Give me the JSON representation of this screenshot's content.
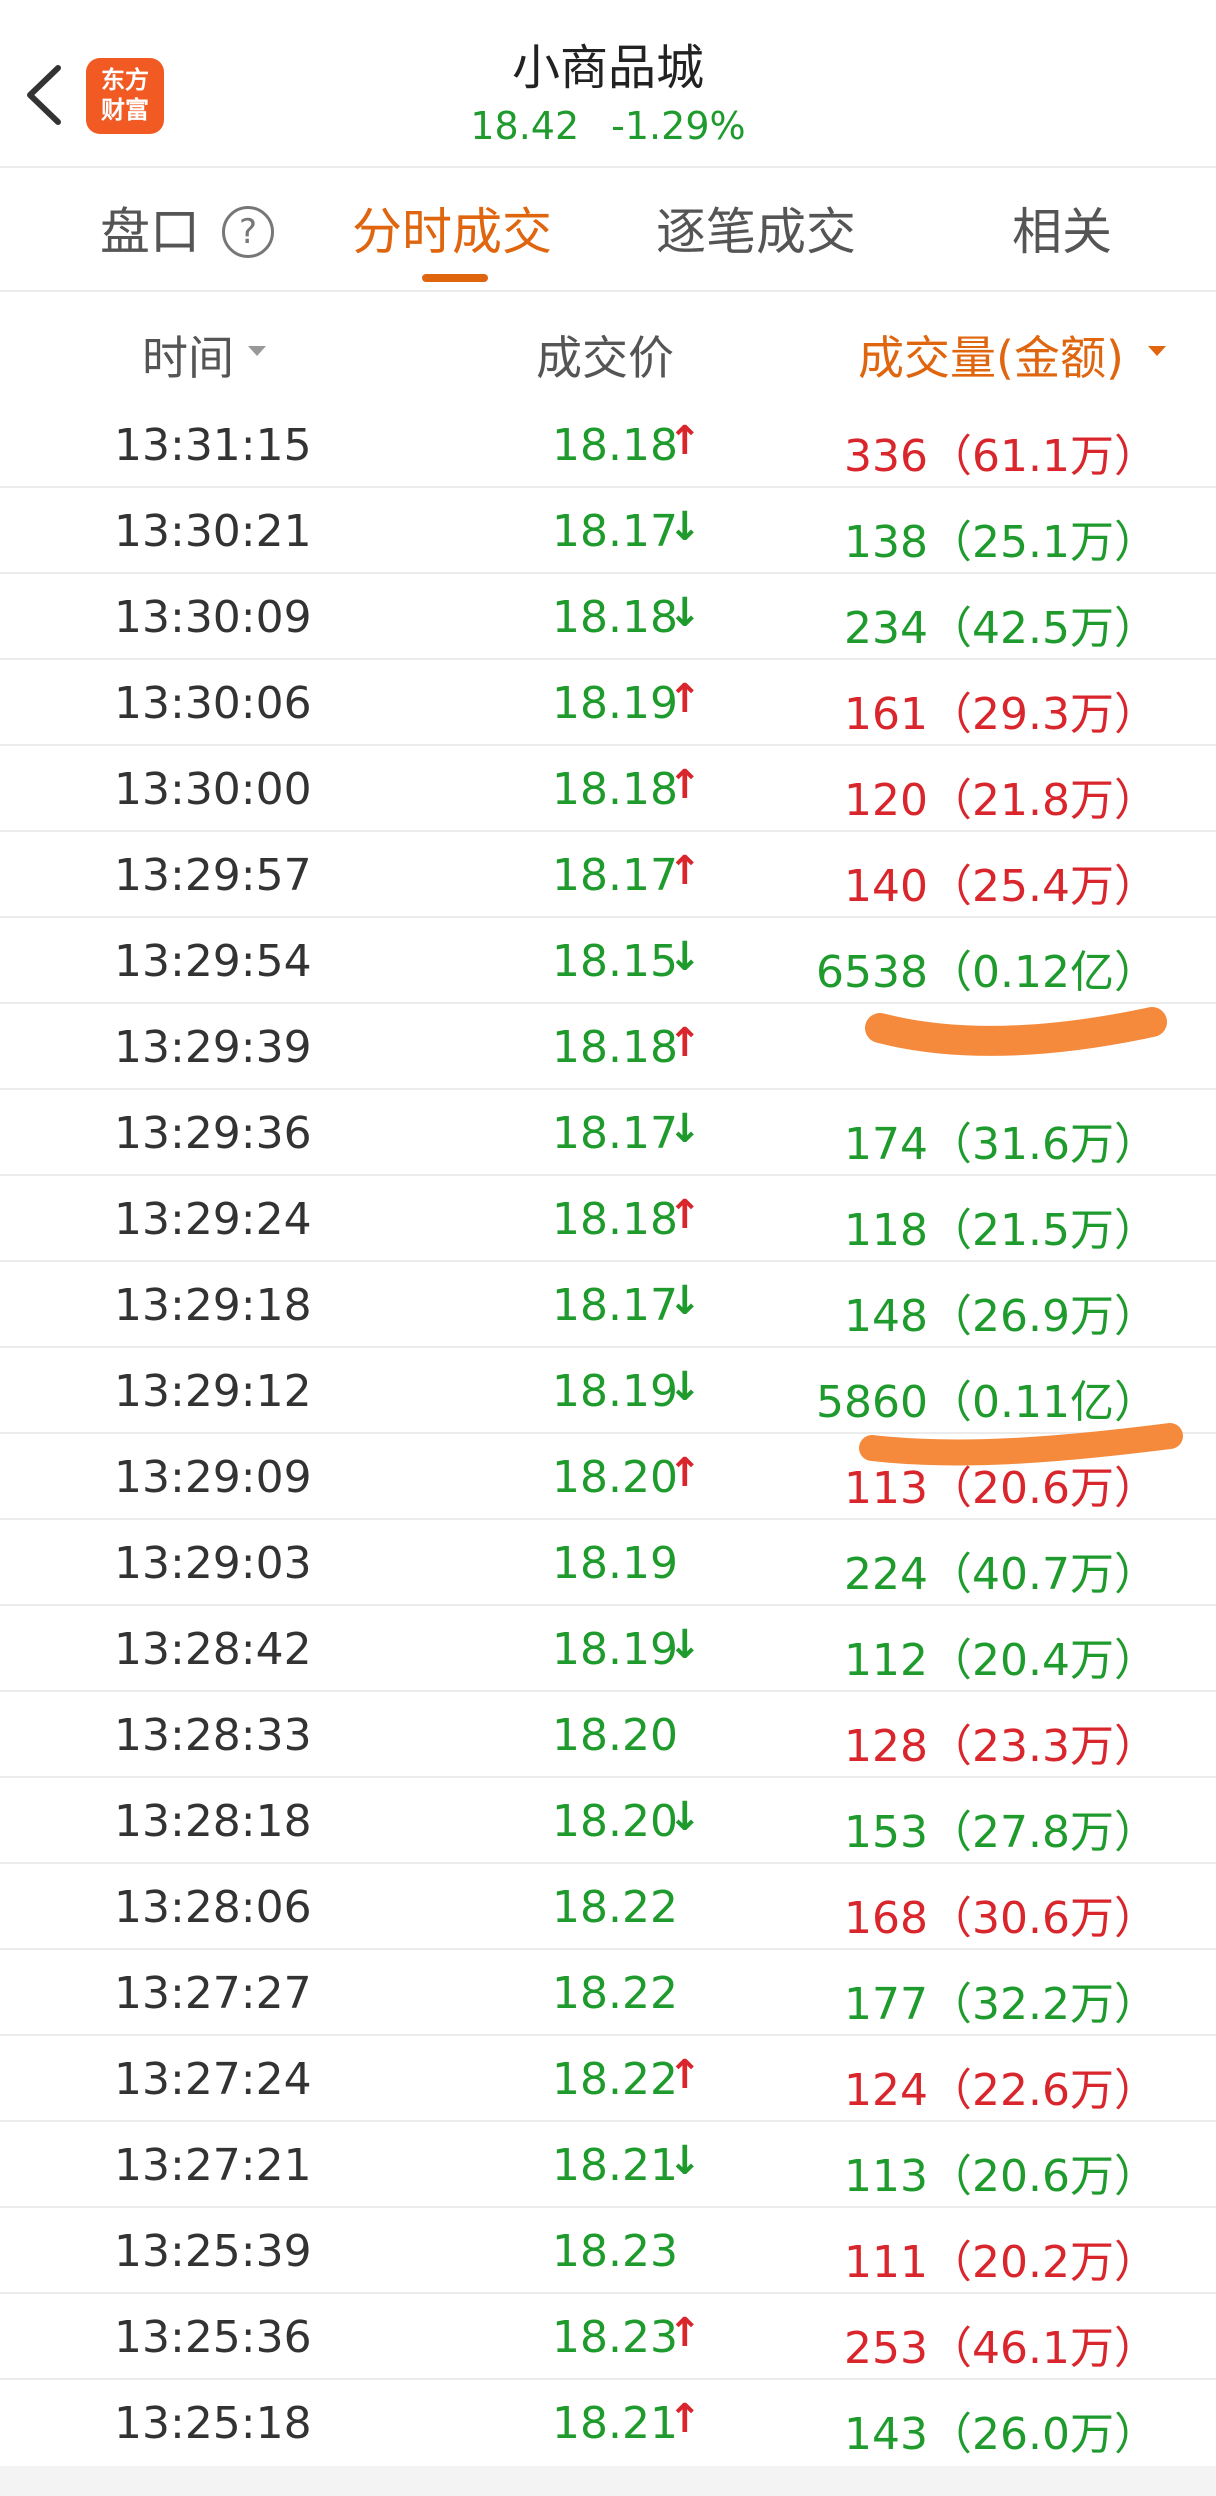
{
  "header": {
    "title": "小商品城",
    "price": "18.42",
    "change_pct": "-1.29%",
    "logo_line1": "东方",
    "logo_line2": "财富"
  },
  "tabs": [
    {
      "label": "盘口",
      "active": false
    },
    {
      "label": "分时成交",
      "active": true
    },
    {
      "label": "逐笔成交",
      "active": false
    },
    {
      "label": "相关",
      "active": false
    }
  ],
  "help_icon_glyph": "?",
  "columns": {
    "time": "时间",
    "price": "成交价",
    "volume": "成交量(金额)"
  },
  "colors": {
    "up": "#d9262c",
    "down": "#1f9b2e",
    "accent": "#e0650f",
    "highlighter": "#f58a3c"
  },
  "rows": [
    {
      "time": "13:31:15",
      "price": "18.18",
      "dir": "up",
      "vol": "336（61.1万）",
      "vol_color": "red"
    },
    {
      "time": "13:30:21",
      "price": "18.17",
      "dir": "down",
      "vol": "138（25.1万）",
      "vol_color": "green"
    },
    {
      "time": "13:30:09",
      "price": "18.18",
      "dir": "down",
      "vol": "234（42.5万）",
      "vol_color": "green"
    },
    {
      "time": "13:30:06",
      "price": "18.19",
      "dir": "up",
      "vol": "161（29.3万）",
      "vol_color": "red"
    },
    {
      "time": "13:30:00",
      "price": "18.18",
      "dir": "up",
      "vol": "120（21.8万）",
      "vol_color": "red"
    },
    {
      "time": "13:29:57",
      "price": "18.17",
      "dir": "up",
      "vol": "140（25.4万）",
      "vol_color": "red"
    },
    {
      "time": "13:29:54",
      "price": "18.15",
      "dir": "down",
      "vol": "6538（0.12亿）",
      "vol_color": "green"
    },
    {
      "time": "13:29:39",
      "price": "18.18",
      "dir": "up",
      "vol": "",
      "vol_color": "red"
    },
    {
      "time": "13:29:36",
      "price": "18.17",
      "dir": "down",
      "vol": "174（31.6万）",
      "vol_color": "green"
    },
    {
      "time": "13:29:24",
      "price": "18.18",
      "dir": "up",
      "vol": "118（21.5万）",
      "vol_color": "green"
    },
    {
      "time": "13:29:18",
      "price": "18.17",
      "dir": "down",
      "vol": "148（26.9万）",
      "vol_color": "green"
    },
    {
      "time": "13:29:12",
      "price": "18.19",
      "dir": "down",
      "vol": "5860（0.11亿）",
      "vol_color": "green"
    },
    {
      "time": "13:29:09",
      "price": "18.20",
      "dir": "up",
      "vol": "113（20.6万）",
      "vol_color": "red"
    },
    {
      "time": "13:29:03",
      "price": "18.19",
      "dir": "none",
      "vol": "224（40.7万）",
      "vol_color": "green"
    },
    {
      "time": "13:28:42",
      "price": "18.19",
      "dir": "down",
      "vol": "112（20.4万）",
      "vol_color": "green"
    },
    {
      "time": "13:28:33",
      "price": "18.20",
      "dir": "none",
      "vol": "128（23.3万）",
      "vol_color": "red"
    },
    {
      "time": "13:28:18",
      "price": "18.20",
      "dir": "down",
      "vol": "153（27.8万）",
      "vol_color": "green"
    },
    {
      "time": "13:28:06",
      "price": "18.22",
      "dir": "none",
      "vol": "168（30.6万）",
      "vol_color": "red"
    },
    {
      "time": "13:27:27",
      "price": "18.22",
      "dir": "none",
      "vol": "177（32.2万）",
      "vol_color": "green"
    },
    {
      "time": "13:27:24",
      "price": "18.22",
      "dir": "up",
      "vol": "124（22.6万）",
      "vol_color": "red"
    },
    {
      "time": "13:27:21",
      "price": "18.21",
      "dir": "down",
      "vol": "113（20.6万）",
      "vol_color": "green"
    },
    {
      "time": "13:25:39",
      "price": "18.23",
      "dir": "none",
      "vol": "111（20.2万）",
      "vol_color": "red"
    },
    {
      "time": "13:25:36",
      "price": "18.23",
      "dir": "up",
      "vol": "253（46.1万）",
      "vol_color": "red"
    },
    {
      "time": "13:25:18",
      "price": "18.21",
      "dir": "up",
      "vol": "143（26.0万）",
      "vol_color": "green"
    }
  ]
}
